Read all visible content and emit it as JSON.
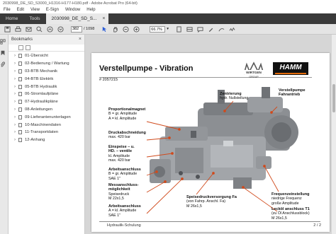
{
  "window": {
    "title": "2030998_DE_SD_S3000_H1316-H177-H180.pdf - Adobe Acrobat Pro (64-bit)"
  },
  "menu": [
    "File",
    "Edit",
    "View",
    "E-Sign",
    "Window",
    "Help"
  ],
  "tabs": {
    "home": "Home",
    "tools": "Tools",
    "doc": "2030998_DE_SD_S..."
  },
  "toolbar": {
    "page_current": "382",
    "page_total": "/ 1098",
    "zoom": "66.7%"
  },
  "bookmarks": {
    "header": "Bookmarks",
    "items": [
      "01-Übersicht",
      "02-Bedienung / Wartung",
      "03-BTB Mechanik",
      "04-BTB Elektrik",
      "05-BTB Hydraulik",
      "06-Stromlaufpläne",
      "07-Hydraulikpläne",
      "08-Anleitungen",
      "09-Lieferantenunterlagen",
      "10-Maschinendaten",
      "11-Transportdaten",
      "12-Anhang"
    ]
  },
  "slide": {
    "title": "Verstellpumpe - Vibration",
    "docnum": "# 2057215",
    "logo_wirtgen": "WIRTGEN GROUP",
    "logo_hamm": "HAMM",
    "footer_left": "Hydraulik-Schulung",
    "footer_right": "2 / 2",
    "labels": {
      "proportional": {
        "title": "Proportionalmagnet",
        "l1": "B = gr. Amplitude",
        "l2": "A = kl. Amplitude"
      },
      "zentrierung": {
        "title": "Zentrierung",
        "l1": "hydr. Nullstellung"
      },
      "verstellpumpe": {
        "title": "Verstellpumpe",
        "l1": "Fahrantrieb"
      },
      "druckabschneidung": {
        "title": "Druckabschneidung",
        "l1": "max. 420 bar"
      },
      "einspeise": {
        "title": "Einspeise – u.",
        "t2": "HD. – ventile",
        "l1": "kl. Amplitude",
        "l2": "max. 420 bar"
      },
      "arbeitsanschluss_b": {
        "title": "Arbeitsanschluss",
        "l1": "B = gr. Amplitude",
        "l2": "SAE 1\""
      },
      "messanschluss": {
        "title": "Messanschluss-",
        "t2": "möglichkeit",
        "l1": "Speisedruck",
        "l2": "M 22x1,5"
      },
      "arbeitsanschluss_a": {
        "title": "Arbeitsanschluss",
        "l1": "A = kl. Amplitude",
        "l2": "SAE 1\""
      },
      "speisedruck": {
        "title": "Speisedruckversorgung Fa",
        "l1": "(von Fahrp. Anschl. Fa)",
        "l2": "M 26x1,5"
      },
      "frequenz": {
        "title": "Frequenzeinstellung",
        "l1": "niedrige Frequenz",
        "l2": "große Amplitude"
      },
      "leckoel": {
        "title": "Lecköl anschluss T1",
        "l1": "(zu Öl Anschlussblock)",
        "l2": "M 26x1,5"
      }
    }
  }
}
